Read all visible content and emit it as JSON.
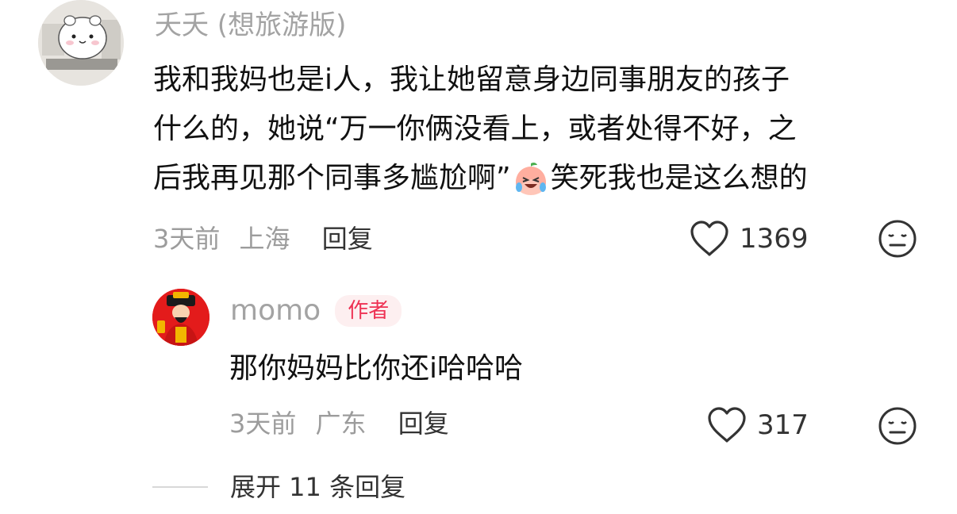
{
  "comment": {
    "username": "夭夭 (想旅游版)",
    "text_lines": [
      "我和我妈也是i人，我让她留意身边同事朋友的孩子",
      "什么的，她说“万一你俩没看上，或者处得不好，之",
      "后我再见那个同事多尴尬啊”",
      "笑死我也是这么想的"
    ],
    "time": "3天前",
    "location": "上海",
    "reply_label": "回复",
    "like_count": "1369",
    "avatar_icon": "hamster-avatar",
    "emoji_icon": "crying-laughing-peach-emoji"
  },
  "reply": {
    "username": "momo",
    "author_badge": "作者",
    "text": "那你妈妈比你还i哈哈哈",
    "time": "3天前",
    "location": "广东",
    "reply_label": "回复",
    "like_count": "317",
    "avatar_icon": "god-of-wealth-avatar"
  },
  "expand_label": "展开 11 条回复",
  "colors": {
    "badge_bg": "#fdeff0",
    "badge_text": "#ee3153",
    "meta_grey": "#9c9c9c"
  }
}
